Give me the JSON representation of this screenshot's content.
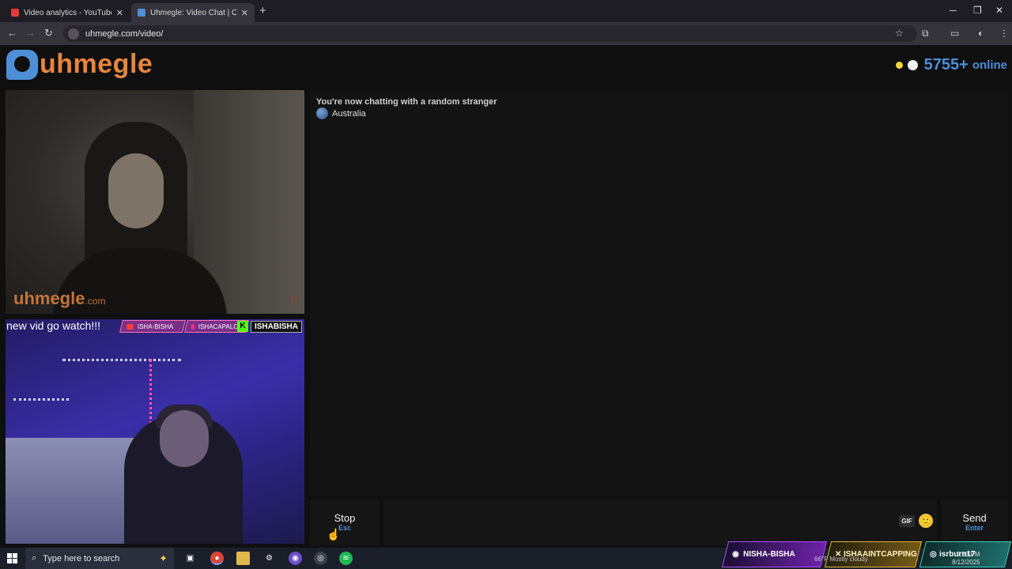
{
  "browser": {
    "tabs": [
      {
        "title": "Video analytics - YouTube Studio",
        "favicon_color": "#e33b3b"
      },
      {
        "title": "Uhmegle: Video Chat | Omegle Alternative",
        "favicon_color": "#4e8fd8"
      }
    ],
    "new_tab": "+",
    "window_controls": {
      "minimize": "─",
      "maximize": "❐",
      "close": "✕"
    },
    "nav": {
      "back": "←",
      "forward": "→",
      "reload": "↻"
    },
    "url": "uhmegle.com/video/",
    "toolbar_icons": [
      "star-icon",
      "extensions-icon",
      "sidepanel-icon",
      "profile-icon",
      "menu-icon"
    ]
  },
  "site": {
    "logo_text": "uhmegle",
    "online_count": "5755+",
    "online_label": "online"
  },
  "stranger_video": {
    "watermark": "uhmegle",
    "watermark_suffix": ".com",
    "report_icon": "flag-icon"
  },
  "self_video": {
    "overlay_note": "new vid go watch!!!",
    "tags": [
      "ISHA-BISHA",
      "ISHACAPALOT"
    ],
    "kick_badge": "K",
    "kick_name": "ISHABISHA"
  },
  "chat": {
    "status": "You're now chatting with a random stranger",
    "country": "Australia"
  },
  "controls": {
    "stop_label": "Stop",
    "stop_key": "Esc",
    "gif_label": "GIF",
    "emoji": "🙂",
    "send_label": "Send",
    "send_key": "Enter"
  },
  "taskbar": {
    "search_placeholder": "Type here to search",
    "overlays": [
      "NISHA-BISHA",
      "ISHAAINTCAPPING",
      "isrburn17"
    ],
    "weather": "66°F  Mostly cloudy",
    "time": "5:28 PM",
    "date": "8/12/2025"
  },
  "colors": {
    "accent_blue": "#4e8fd8",
    "logo_orange": "#e8853d"
  }
}
